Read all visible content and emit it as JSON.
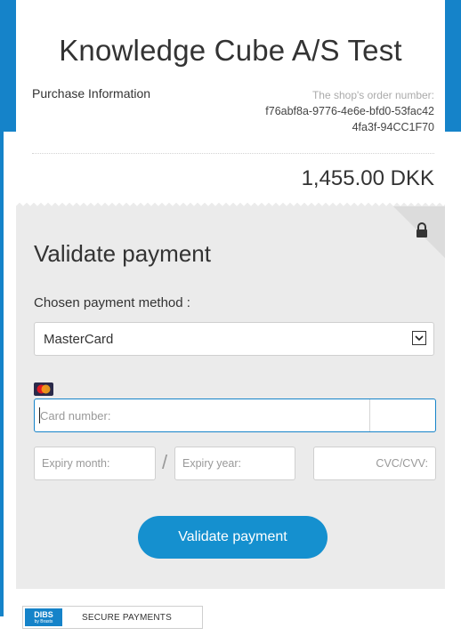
{
  "header": {
    "shop_name": "Knowledge Cube A/S Test",
    "purchase_info_label": "Purchase Information",
    "order_number_label": "The shop's order number:",
    "order_number": "f76abf8a-9776-4e6e-bfd0-53fac424fa3f-94CC1F70",
    "amount": "1,455.00 DKK"
  },
  "payment": {
    "title": "Validate payment",
    "method_label": "Chosen payment method :",
    "selected_method": "MasterCard",
    "card_number_placeholder": "Card number:",
    "expiry_month_placeholder": "Expiry month:",
    "expiry_year_placeholder": "Expiry year:",
    "cvc_placeholder": "CVC/CVV:",
    "separator": "/",
    "submit_label": "Validate payment"
  },
  "footer": {
    "logo_main": "DIBS",
    "logo_sub": "by Brasts",
    "secure_label": "SECURE PAYMENTS"
  },
  "icons": {
    "lock": "lock-icon",
    "card": "mastercard-icon",
    "dropdown": "chevron-down-icon"
  },
  "colors": {
    "brand_blue": "#1583c9",
    "button_blue": "#1590cf"
  }
}
